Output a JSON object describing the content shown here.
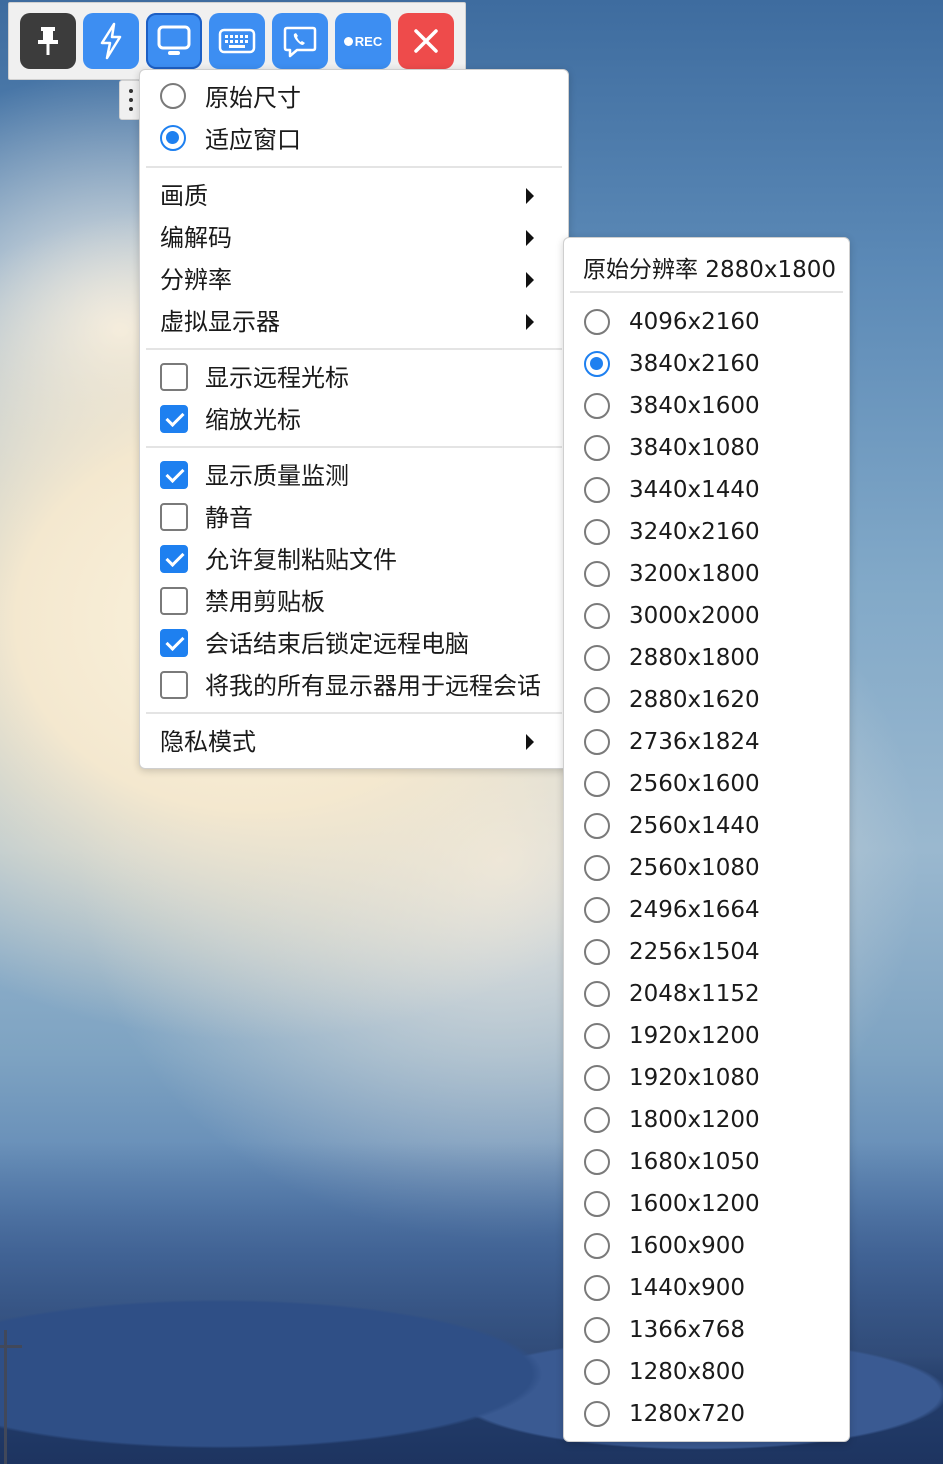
{
  "toolbar": {
    "buttons": [
      {
        "name": "pin",
        "icon": "pin-icon",
        "color": "#3c3c3c"
      },
      {
        "name": "actions",
        "icon": "lightning-icon",
        "color": "#3d8ef2"
      },
      {
        "name": "display",
        "icon": "monitor-icon",
        "color": "#3d8ef2"
      },
      {
        "name": "keyboard",
        "icon": "keyboard-icon",
        "color": "#3d8ef2"
      },
      {
        "name": "chat",
        "icon": "chat-phone-icon",
        "color": "#3d8ef2"
      },
      {
        "name": "record",
        "icon": "record-icon",
        "label": "REC",
        "color": "#3d8ef2"
      },
      {
        "name": "close",
        "icon": "close-icon",
        "color": "#ee4b4b"
      }
    ]
  },
  "display_menu": {
    "scale_options": [
      {
        "label": "原始尺寸",
        "selected": false
      },
      {
        "label": "适应窗口",
        "selected": true
      }
    ],
    "submenus": [
      {
        "label": "画质"
      },
      {
        "label": "编解码"
      },
      {
        "label": "分辨率"
      },
      {
        "label": "虚拟显示器"
      }
    ],
    "cursor_options": [
      {
        "label": "显示远程光标",
        "checked": false
      },
      {
        "label": "缩放光标",
        "checked": true
      }
    ],
    "toggles": [
      {
        "label": "显示质量监测",
        "checked": true
      },
      {
        "label": "静音",
        "checked": false
      },
      {
        "label": "允许复制粘贴文件",
        "checked": true
      },
      {
        "label": "禁用剪贴板",
        "checked": false
      },
      {
        "label": "会话结束后锁定远程电脑",
        "checked": true
      },
      {
        "label": "将我的所有显示器用于远程会话",
        "checked": false
      }
    ],
    "privacy": {
      "label": "隐私模式"
    }
  },
  "resolution_menu": {
    "header": "原始分辨率 2880x1800",
    "selected_index": 1,
    "options": [
      "4096x2160",
      "3840x2160",
      "3840x1600",
      "3840x1080",
      "3440x1440",
      "3240x2160",
      "3200x1800",
      "3000x2000",
      "2880x1800",
      "2880x1620",
      "2736x1824",
      "2560x1600",
      "2560x1440",
      "2560x1080",
      "2496x1664",
      "2256x1504",
      "2048x1152",
      "1920x1200",
      "1920x1080",
      "1800x1200",
      "1680x1050",
      "1600x1200",
      "1600x900",
      "1440x900",
      "1366x768",
      "1280x800",
      "1280x720"
    ]
  },
  "colors": {
    "accent": "#1e80f0",
    "toolbar_blue": "#3d8ef2",
    "close_red": "#ee4b4b"
  }
}
